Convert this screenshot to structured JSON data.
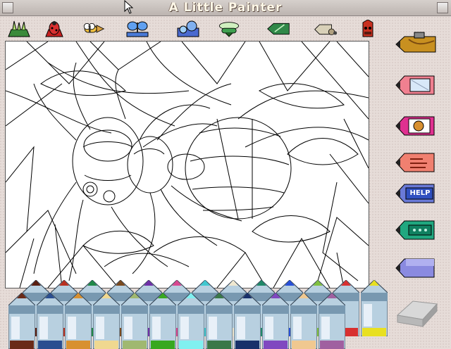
{
  "window": {
    "title": "A  Little  Painter"
  },
  "top_tools": [
    {
      "name": "grass-tool",
      "icon": "grass-icon"
    },
    {
      "name": "ladybug-tool",
      "icon": "ladybug-icon"
    },
    {
      "name": "bee-tool",
      "icon": "bee-icon"
    },
    {
      "name": "butterfly-tool",
      "icon": "butterfly-icon"
    },
    {
      "name": "fish-tool",
      "icon": "fish-icon"
    },
    {
      "name": "dragonfly-tool",
      "icon": "dragonfly-icon"
    },
    {
      "name": "leaf-tool",
      "icon": "leaf-icon"
    },
    {
      "name": "snail-tool",
      "icon": "snail-icon"
    },
    {
      "name": "beetle-tool",
      "icon": "beetle-icon"
    }
  ],
  "side_tools": [
    {
      "name": "music-tool",
      "icon": "trumpet-icon"
    },
    {
      "name": "page-tool",
      "icon": "page-icon"
    },
    {
      "name": "picture-tool",
      "icon": "picture-icon"
    },
    {
      "name": "hand-tool",
      "icon": "hand-icon"
    },
    {
      "name": "help-tool",
      "icon": "help-icon",
      "label": "HELP"
    },
    {
      "name": "options-tool",
      "icon": "options-icon"
    },
    {
      "name": "blank-tool",
      "icon": "blank-pencil-icon"
    }
  ],
  "eraser": {
    "icon": "eraser-icon"
  },
  "colors": {
    "crayons_top": [
      "#5a1e10",
      "#b83020",
      "#208848",
      "#7a4a20",
      "#7030a8",
      "#d84890",
      "#40c8d0",
      "#f0e8d0",
      "#208868",
      "#2850d8",
      "#80c040",
      "#d83030",
      "#e8e020"
    ],
    "crayons_bottom": [
      "#6a2a18",
      "#2a4e90",
      "#d89030",
      "#f0d890",
      "#a0b870",
      "#38a820",
      "#80f0f0",
      "#3a7848",
      "#18306a",
      "#8048c0",
      "#f0c890",
      "#a060a0"
    ]
  }
}
